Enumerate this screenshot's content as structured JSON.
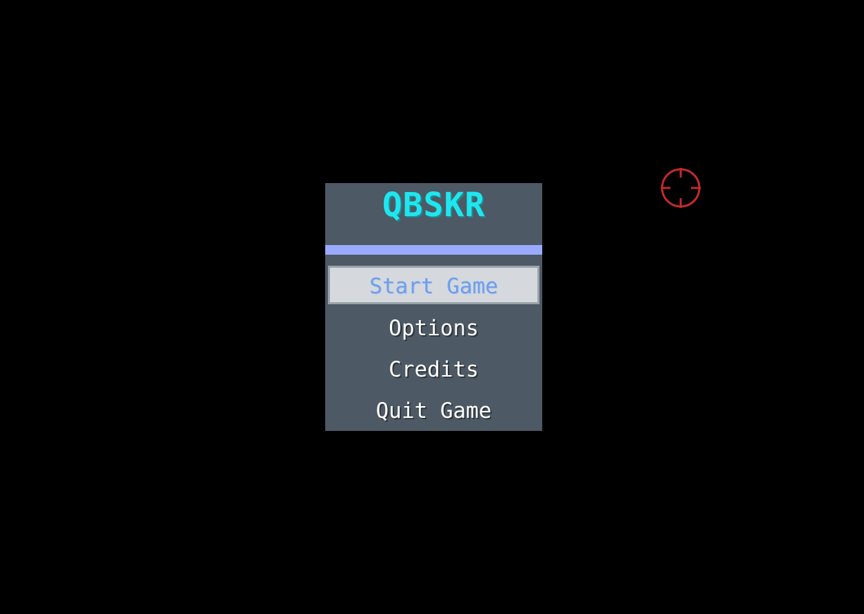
{
  "game": {
    "title": "QBSKR"
  },
  "menu": {
    "items": [
      {
        "label": "Start Game",
        "selected": true
      },
      {
        "label": "Options",
        "selected": false
      },
      {
        "label": "Credits",
        "selected": false
      },
      {
        "label": "Quit Game",
        "selected": false
      }
    ]
  },
  "colors": {
    "background": "#000000",
    "panel": "#4d5964",
    "title": "#1fe6ee",
    "divider": "#9aaaff",
    "selected_bg": "#d5d9dd",
    "selected_text": "#6d9ff0",
    "item_text": "#ffffff",
    "cursor": "#c42a2a"
  },
  "cursor": {
    "icon": "crosshair-icon"
  }
}
